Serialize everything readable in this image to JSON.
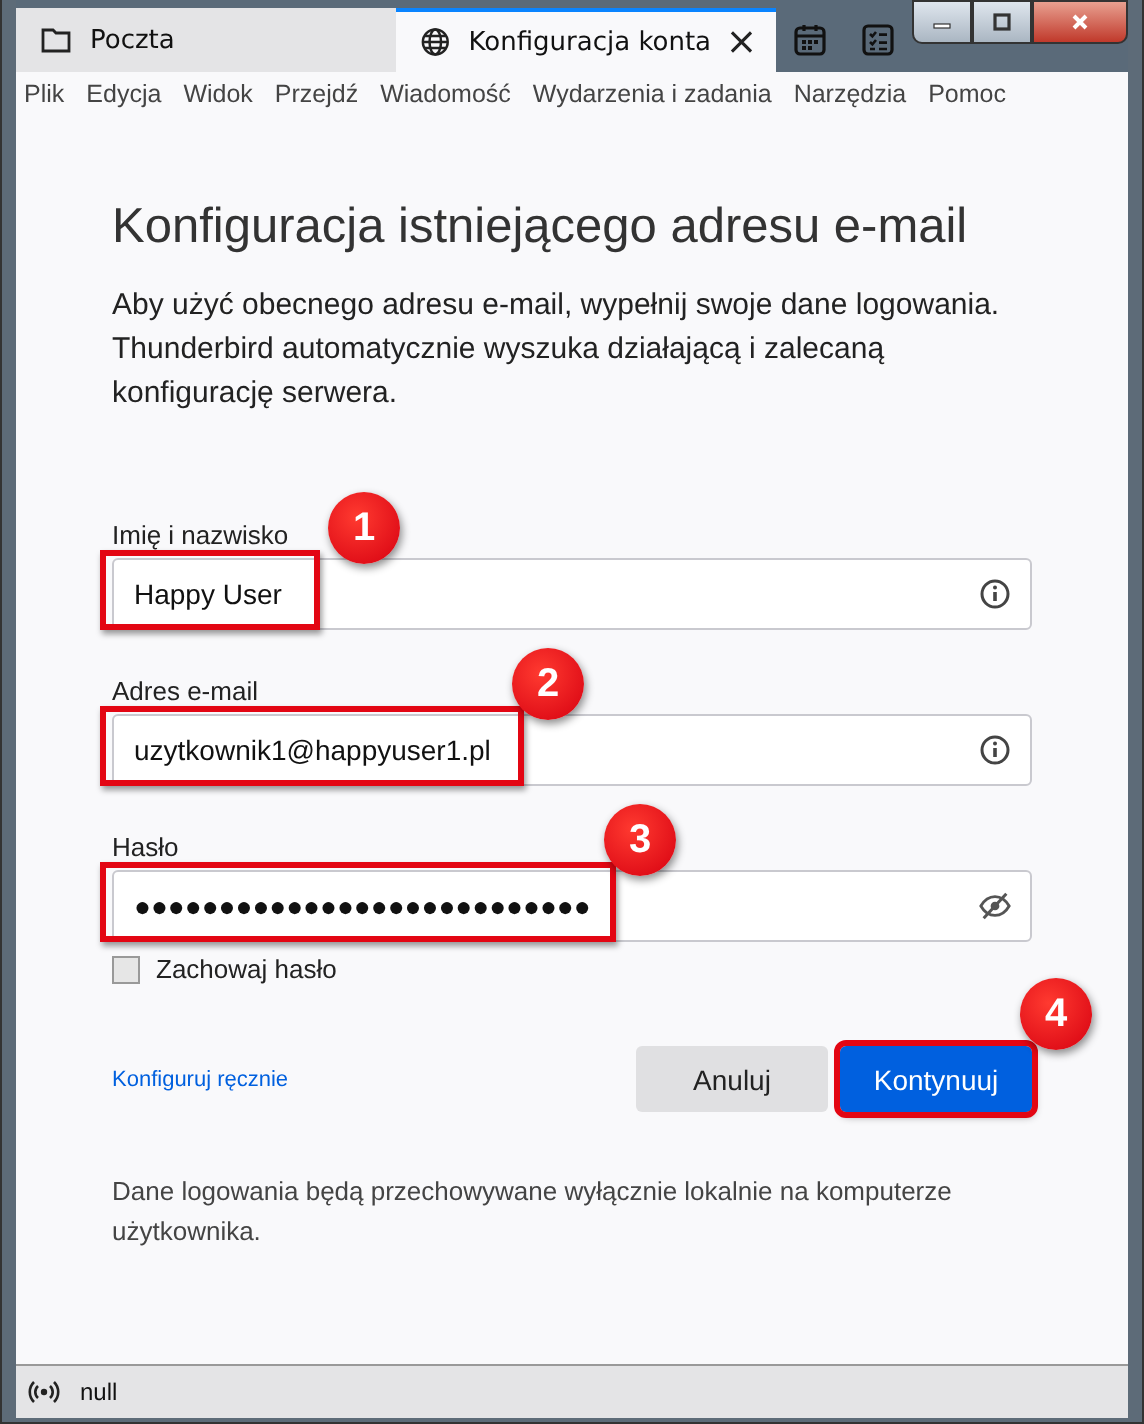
{
  "tabs": [
    {
      "label": "Poczta",
      "selected": false
    },
    {
      "label": "Konfiguracja konta",
      "selected": true
    }
  ],
  "menu": [
    "Plik",
    "Edycja",
    "Widok",
    "Przejdź",
    "Wiadomość",
    "Wydarzenia i zadania",
    "Narzędzia",
    "Pomoc"
  ],
  "heading": "Konfiguracja istniejącego adresu e-mail",
  "description": "Aby użyć obecnego adresu e-mail, wypełnij swoje dane logowania. Thunderbird automatycznie wyszuka działającą i zalecaną konfigurację serwera.",
  "fields": [
    {
      "kind": "text",
      "label": "Imię i nazwisko",
      "value": "Happy User",
      "highlighted": true,
      "badge": "1"
    },
    {
      "kind": "text",
      "label": "Adres e-mail",
      "value": "uzytkownik1@happyuser1.pl",
      "highlighted": true,
      "badge": "2"
    },
    {
      "kind": "password",
      "label": "Hasło",
      "value": "●●●●●●●●●●●●●●●●●●●●●●●●●●●",
      "highlighted": true,
      "badge": "3"
    }
  ],
  "remember_password": {
    "label": "Zachowaj hasło",
    "checked": false
  },
  "manual_link": "Konfiguruj ręcznie",
  "buttons": [
    {
      "label": "Anuluj",
      "kind": "secondary",
      "highlighted": false
    },
    {
      "label": "Kontynuuj",
      "kind": "primary",
      "highlighted": true,
      "badge": "4"
    }
  ],
  "footnote": "Dane logowania będą przechowywane wyłącznie lokalnie na komputerze użytkownika.",
  "status_bar": {
    "text": "null"
  }
}
